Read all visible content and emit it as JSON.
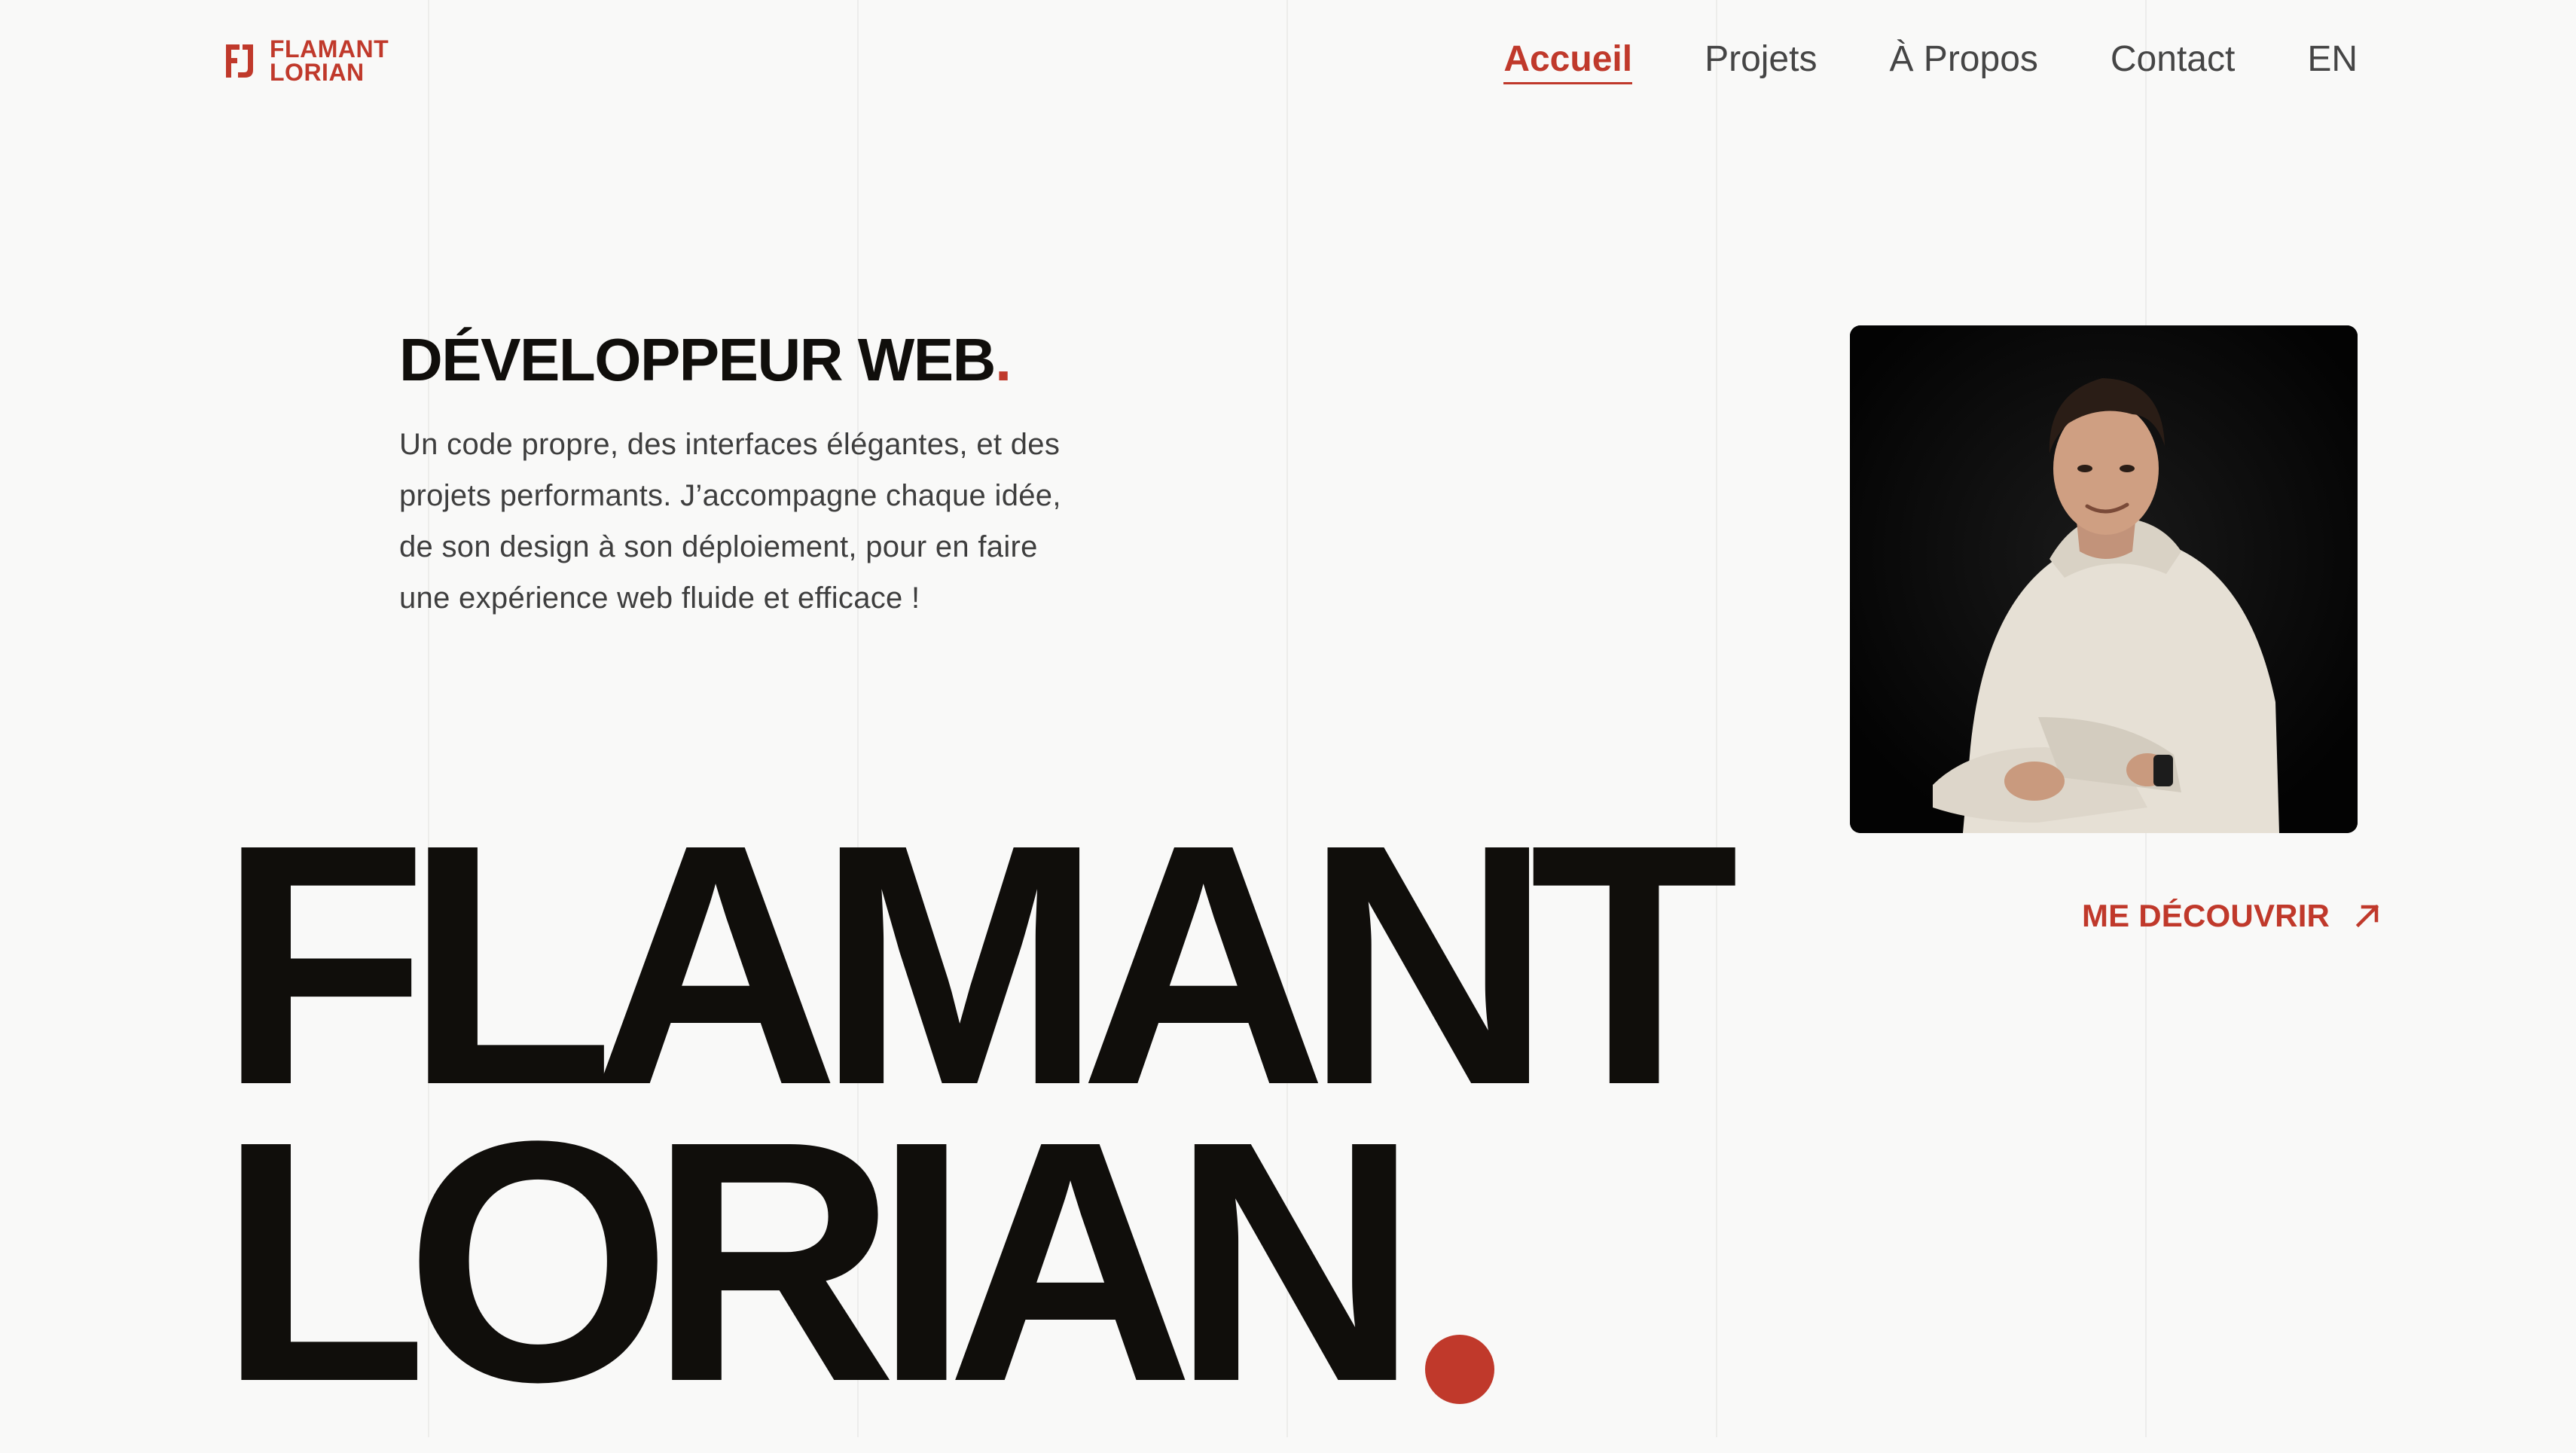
{
  "logo": {
    "mark": "FJ",
    "line1": "FLAMANT",
    "line2": "LORIAN"
  },
  "nav": {
    "items": [
      {
        "label": "Accueil",
        "active": true
      },
      {
        "label": "Projets",
        "active": false
      },
      {
        "label": "À Propos",
        "active": false
      },
      {
        "label": "Contact",
        "active": false
      }
    ],
    "language": "EN"
  },
  "hero": {
    "role": "DÉVELOPPEUR WEB",
    "role_dot": ".",
    "intro": "Un code propre, des interfaces élégantes, et des projets performants. J’accompagne chaque idée, de son design à son déploiement, pour en faire une expérience web fluide et efficace !",
    "cta_label": "ME DÉCOUVRIR",
    "cta_icon": "arrow-up-right-icon",
    "name_line1": "FLAMANT",
    "name_line2": "LORIAN"
  },
  "portrait": {
    "icon": "portrait-photo"
  },
  "colors": {
    "accent": "#c0392b",
    "text": "#100e0b",
    "background": "#f9f9f8"
  }
}
